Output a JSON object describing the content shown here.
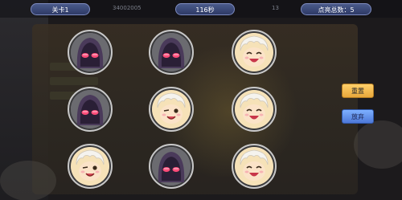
{
  "hud": {
    "level": "关卡1",
    "time": "116秒",
    "lit_total": "点亮总数：5",
    "faded_left": "34002005",
    "faded_mid": "13"
  },
  "buttons": {
    "reset": "重置",
    "giveup": "放弃"
  },
  "grid": {
    "rows": 3,
    "cols": 3,
    "cells": [
      [
        "hooded-lit",
        "hooded-lit",
        "boy-happy"
      ],
      [
        "hooded-lit",
        "boy-wink",
        "boy-happy"
      ],
      [
        "boy-wink",
        "hooded-lit",
        "boy-happy"
      ]
    ]
  },
  "colors": {
    "hud_pill": "#2e3a66",
    "reset_button": "#e8a73b",
    "giveup_button": "#4d78d8",
    "lit_eyes": "#ff4d7a"
  }
}
